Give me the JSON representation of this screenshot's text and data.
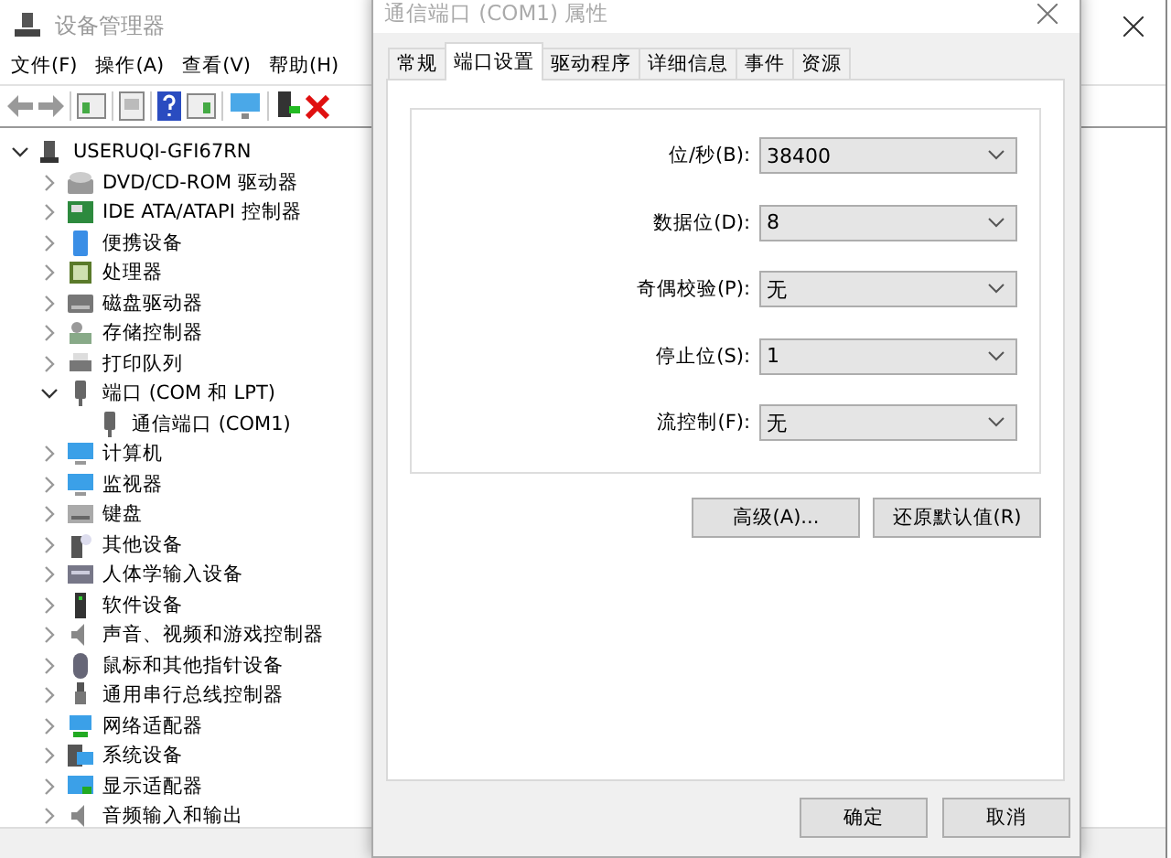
{
  "window": {
    "title": "设备管理器"
  },
  "menu": [
    "文件(F)",
    "操作(A)",
    "查看(V)",
    "帮助(H)"
  ],
  "toolbar": [
    {
      "kind": "back"
    },
    {
      "kind": "forward"
    },
    {
      "kind": "sep"
    },
    {
      "kind": "view"
    },
    {
      "kind": "sep"
    },
    {
      "kind": "properties"
    },
    {
      "kind": "sep"
    },
    {
      "kind": "help"
    },
    {
      "kind": "view2"
    },
    {
      "kind": "sep"
    },
    {
      "kind": "scan"
    },
    {
      "kind": "sep"
    },
    {
      "kind": "driver"
    },
    {
      "kind": "remove"
    }
  ],
  "tree": [
    {
      "label": "USERUQI-GFI67RN",
      "kind": "computer",
      "expanded": true,
      "children": [
        {
          "label": "DVD/CD-ROM 驱动器",
          "kind": "disc",
          "expanded": false
        },
        {
          "label": "IDE ATA/ATAPI 控制器",
          "kind": "board",
          "expanded": false
        },
        {
          "label": "便携设备",
          "kind": "phone",
          "expanded": false
        },
        {
          "label": "处理器",
          "kind": "chip",
          "expanded": false
        },
        {
          "label": "磁盘驱动器",
          "kind": "drive",
          "expanded": false
        },
        {
          "label": "存储控制器",
          "kind": "storage",
          "expanded": false
        },
        {
          "label": "打印队列",
          "kind": "printer",
          "expanded": false
        },
        {
          "label": "端口 (COM 和 LPT)",
          "kind": "port",
          "expanded": true,
          "children": [
            {
              "label": "通信端口 (COM1)",
              "kind": "port"
            }
          ]
        },
        {
          "label": "计算机",
          "kind": "monitor",
          "expanded": false
        },
        {
          "label": "监视器",
          "kind": "monitor",
          "expanded": false
        },
        {
          "label": "键盘",
          "kind": "keyboard",
          "expanded": false
        },
        {
          "label": "其他设备",
          "kind": "unknown",
          "expanded": false
        },
        {
          "label": "人体学输入设备",
          "kind": "hid",
          "expanded": false
        },
        {
          "label": "软件设备",
          "kind": "software",
          "expanded": false
        },
        {
          "label": "声音、视频和游戏控制器",
          "kind": "speaker",
          "expanded": false
        },
        {
          "label": "鼠标和其他指针设备",
          "kind": "mouse",
          "expanded": false
        },
        {
          "label": "通用串行总线控制器",
          "kind": "usb",
          "expanded": false
        },
        {
          "label": "网络适配器",
          "kind": "network",
          "expanded": false
        },
        {
          "label": "系统设备",
          "kind": "system",
          "expanded": false
        },
        {
          "label": "显示适配器",
          "kind": "display",
          "expanded": false
        },
        {
          "label": "音频输入和输出",
          "kind": "speaker",
          "expanded": false
        }
      ]
    }
  ],
  "dialog": {
    "title": "通信端口 (COM1) 属性",
    "tabs": [
      {
        "label": "常规",
        "selected": false
      },
      {
        "label": "端口设置",
        "selected": true
      },
      {
        "label": "驱动程序",
        "selected": false
      },
      {
        "label": "详细信息",
        "selected": false
      },
      {
        "label": "事件",
        "selected": false
      },
      {
        "label": "资源",
        "selected": false
      }
    ],
    "fields": [
      {
        "label": "位/秒(B):",
        "value": "38400"
      },
      {
        "label": "数据位(D):",
        "value": "8"
      },
      {
        "label": "奇偶校验(P):",
        "value": "无"
      },
      {
        "label": "停止位(S):",
        "value": "1"
      },
      {
        "label": "流控制(F):",
        "value": "无"
      }
    ],
    "panel_buttons": [
      "高级(A)...",
      "还原默认值(R)"
    ],
    "buttons": [
      "确定",
      "取消"
    ]
  }
}
